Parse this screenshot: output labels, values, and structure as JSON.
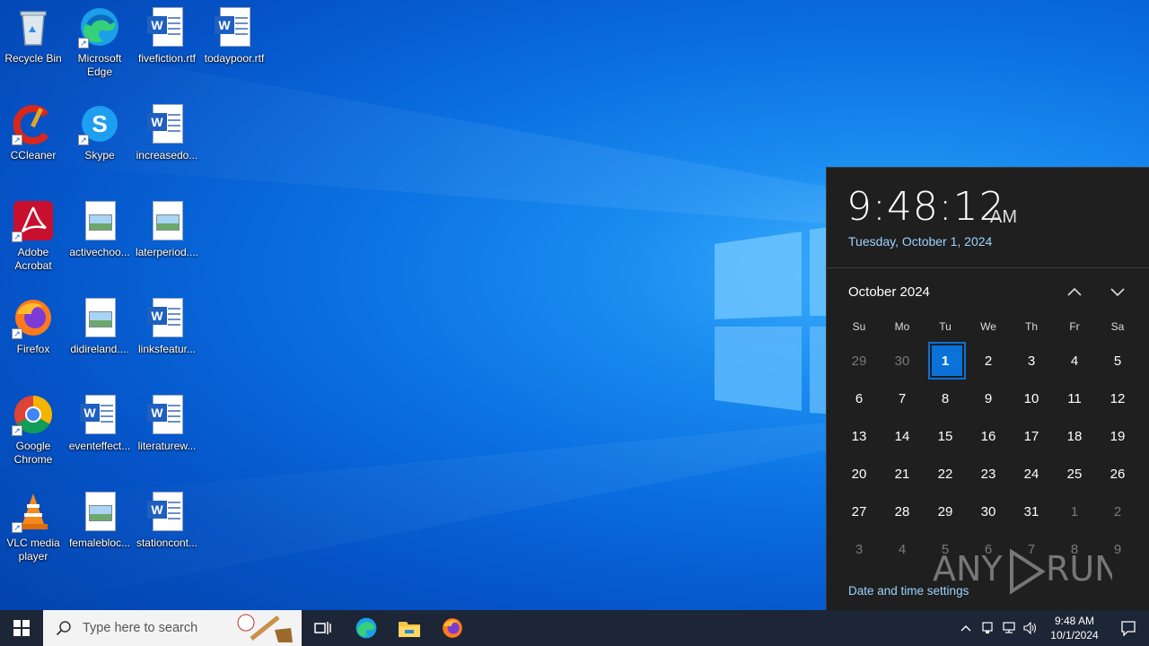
{
  "desktop": {
    "icons": [
      {
        "label": "Recycle Bin",
        "icon": "recycle-bin-icon"
      },
      {
        "label": "Microsoft Edge",
        "icon": "edge-icon"
      },
      {
        "label": "fivefiction.rtf",
        "icon": "word-document-icon"
      },
      {
        "label": "todaypoor.rtf",
        "icon": "word-document-icon"
      },
      {
        "label": "CCleaner",
        "icon": "ccleaner-icon"
      },
      {
        "label": "Skype",
        "icon": "skype-icon"
      },
      {
        "label": "increasedo...",
        "icon": "word-document-icon"
      },
      {
        "label": "Adobe Acrobat",
        "icon": "acrobat-icon"
      },
      {
        "label": "activechoo...",
        "icon": "image-file-icon"
      },
      {
        "label": "laterperiod....",
        "icon": "image-file-icon"
      },
      {
        "label": "Firefox",
        "icon": "firefox-icon"
      },
      {
        "label": "didireland....",
        "icon": "image-file-icon"
      },
      {
        "label": "linksfeatur...",
        "icon": "word-document-icon"
      },
      {
        "label": "Google Chrome",
        "icon": "chrome-icon"
      },
      {
        "label": "eventeffect...",
        "icon": "word-document-icon"
      },
      {
        "label": "literaturew...",
        "icon": "word-document-icon"
      },
      {
        "label": "VLC media player",
        "icon": "vlc-icon"
      },
      {
        "label": "femalebloc...",
        "icon": "image-file-icon"
      },
      {
        "label": "stationcont...",
        "icon": "word-document-icon"
      }
    ]
  },
  "flyout": {
    "time": "9:48:12",
    "ampm": "AM",
    "date": "Tuesday, October 1, 2024",
    "month_label": "October 2024",
    "weekdays": [
      "Su",
      "Mo",
      "Tu",
      "We",
      "Th",
      "Fr",
      "Sa"
    ],
    "weeks": [
      [
        "29",
        "30",
        "1",
        "2",
        "3",
        "4",
        "5"
      ],
      [
        "6",
        "7",
        "8",
        "9",
        "10",
        "11",
        "12"
      ],
      [
        "13",
        "14",
        "15",
        "16",
        "17",
        "18",
        "19"
      ],
      [
        "20",
        "21",
        "22",
        "23",
        "24",
        "25",
        "26"
      ],
      [
        "27",
        "28",
        "29",
        "30",
        "31",
        "1",
        "2"
      ],
      [
        "3",
        "4",
        "5",
        "6",
        "7",
        "8",
        "9"
      ]
    ],
    "today": "1",
    "settings_link": "Date and time settings",
    "watermark": "ANY RUN"
  },
  "taskbar": {
    "search_placeholder": "Type here to search",
    "clock_time": "9:48 AM",
    "clock_date": "10/1/2024"
  },
  "colors": {
    "accent": "#0a72d8",
    "taskbar": "#1c2636",
    "flyout_bg": "#1f1f1f",
    "link": "#9fd1ff"
  }
}
